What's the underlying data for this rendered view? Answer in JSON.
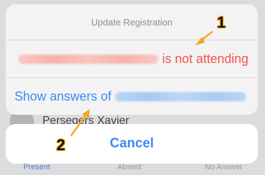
{
  "background": {
    "row_name": "Persegers Xavier",
    "tabs": [
      "Present",
      "Absent",
      "No Answer"
    ]
  },
  "action_sheet": {
    "title": "Update Registration",
    "not_attending_suffix": "is not attending",
    "show_answers_prefix": "Show answers of",
    "cancel_label": "Cancel"
  },
  "annotations": {
    "marker_1": "1",
    "marker_2": "2"
  },
  "colors": {
    "destructive": "#f2534a",
    "tint": "#3b8cf1",
    "annotation": "#f5a623"
  }
}
